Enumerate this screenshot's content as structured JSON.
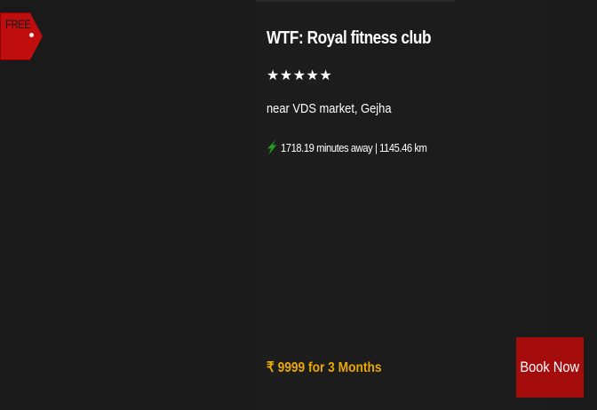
{
  "badge": {
    "label": "FREE"
  },
  "gym": {
    "name": "WTF: Royal fitness club",
    "rating_stars": "★★★★★",
    "rating": 5,
    "address": "near VDS market, Gejha",
    "distance_text": "1718.19 minutes away | 1145.46 km",
    "price_text": "₹ 9999 for 3 Months"
  },
  "actions": {
    "book_label": "Book Now"
  },
  "colors": {
    "background": "#1a1a1a",
    "badge_red": "#c00d0d",
    "button_red": "#a50d0d",
    "price_gold": "#e9a800",
    "nav_arrow_green": "#1fa31f",
    "text_white": "#ffffff"
  },
  "icons": {
    "badge_hole": "tag-hole-icon",
    "distance": "navigation-arrow-icon",
    "rating": "star-icon"
  }
}
